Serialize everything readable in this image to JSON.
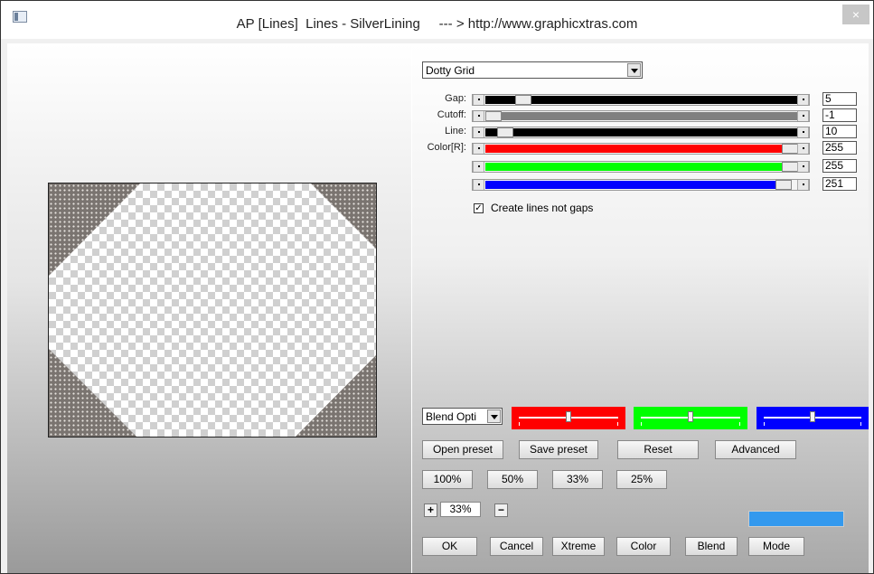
{
  "window": {
    "title": "AP [Lines]  Lines - SilverLining     --- > http://www.graphicxtras.com",
    "close_glyph": "×"
  },
  "preset_dropdown": {
    "value": "Dotty Grid"
  },
  "sliders": [
    {
      "label": "Gap:",
      "value": "5",
      "fill_color": "#000000",
      "fraction": 0.1
    },
    {
      "label": "Cutoff:",
      "value": "-1",
      "fill_color": "#808080",
      "fraction": 0.0
    },
    {
      "label": "Line:",
      "value": "10",
      "fill_color": "#000000",
      "fraction": 0.04
    },
    {
      "label": "Color[R]:",
      "value": "255",
      "fill_color": "#ff0000",
      "fraction": 1.0
    },
    {
      "label": "",
      "value": "255",
      "fill_color": "#00ff00",
      "fraction": 1.0
    },
    {
      "label": "",
      "value": "251",
      "fill_color": "#0000ff",
      "fraction": 0.98
    }
  ],
  "checkbox": {
    "label": "Create lines not gaps",
    "checked": true,
    "mark": "✓"
  },
  "blend_dropdown": {
    "value": "Blend Opti"
  },
  "color_sliders": [
    {
      "color": "#ff0000",
      "fraction": 0.5
    },
    {
      "color": "#00ff00",
      "fraction": 0.5
    },
    {
      "color": "#0000ff",
      "fraction": 0.5
    }
  ],
  "preset_buttons": [
    "Open preset",
    "Save preset",
    "Reset",
    "Advanced"
  ],
  "zoom_buttons": [
    "100%",
    "50%",
    "33%",
    "25%"
  ],
  "zoom": {
    "plus": "+",
    "value": "33%",
    "minus": "−"
  },
  "result_color": "#3399ee",
  "bottom_buttons": [
    "OK",
    "Cancel",
    "Xtreme",
    "Color",
    "Blend",
    "Mode"
  ]
}
